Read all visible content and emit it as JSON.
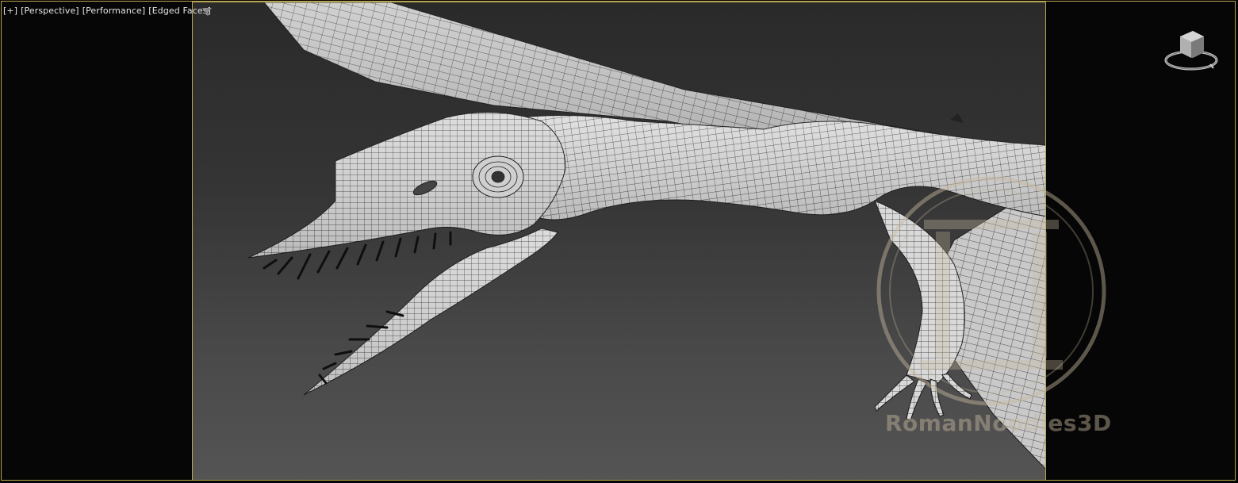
{
  "viewport": {
    "label_plus": "[+]",
    "label_view": "[Perspective]",
    "label_mode": "[Performance]",
    "label_shading": "[Edged Faces]"
  },
  "icons": {
    "filter": "filter-funnel-icon",
    "viewcube": "viewcube-icon",
    "watermark_logo": "column-logo"
  },
  "watermark": {
    "text": "RomanNoodles3D"
  },
  "colors": {
    "frame_border": "#b9a34f",
    "mesh_fill": "#d8d8d8",
    "wire": "#2a2a2a"
  }
}
